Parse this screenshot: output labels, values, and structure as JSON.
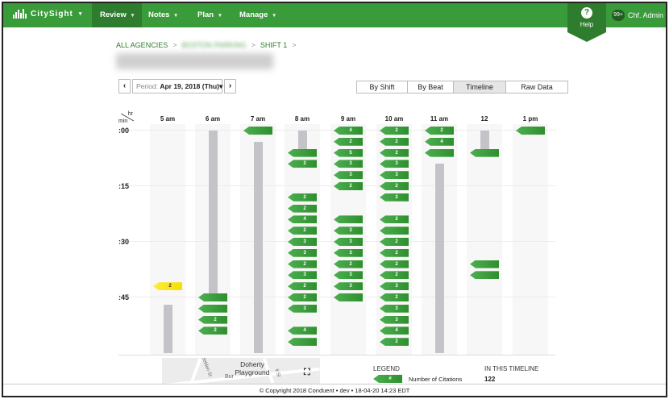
{
  "app": {
    "brand": "CitySight",
    "brand_caret": "▾"
  },
  "nav": {
    "items": [
      {
        "label": "Review",
        "caret": "▾"
      },
      {
        "label": "Notes",
        "caret": "▾"
      },
      {
        "label": "Plan",
        "caret": "▾"
      },
      {
        "label": "Manage",
        "caret": "▾"
      }
    ],
    "help_icon": "?",
    "help_label": "Help",
    "notifications": "99+",
    "user": "Chf. Admin ▾"
  },
  "breadcrumb": {
    "root": "ALL AGENCIES",
    "middle": "BOSTON PARKING",
    "current": "SHIFT 1",
    "separator": ">"
  },
  "period": {
    "prev": "‹",
    "next": "›",
    "label": "Period:",
    "value": "Apr 19, 2018 (Thu)▾"
  },
  "tabs": [
    "By Shift",
    "By Beat",
    "Timeline",
    "Raw Data"
  ],
  "active_tab": "Timeline",
  "timeline": {
    "corner_hr": "hr",
    "corner_min": "min",
    "hours": [
      "5 am",
      "6 am",
      "7 am",
      "8 am",
      "9 am",
      "10 am",
      "11 am",
      "12",
      "1 pm"
    ],
    "minute_labels": [
      ":00",
      ":15",
      ":30",
      ":45"
    ],
    "gray_bars": [
      {
        "hour": 0,
        "start_min": 47,
        "end_min": 60
      },
      {
        "hour": 1,
        "start_min": 0,
        "end_min": 44
      },
      {
        "hour": 2,
        "start_min": 3,
        "end_min": 60
      },
      {
        "hour": 3,
        "start_min": 0,
        "end_min": 6
      },
      {
        "hour": 6,
        "start_min": 9,
        "end_min": 60
      },
      {
        "hour": 7,
        "start_min": 0,
        "end_min": 6
      }
    ],
    "citations": [
      {
        "hour": 0,
        "min": 42,
        "count": "2",
        "color": "yellow"
      },
      {
        "hour": 1,
        "min": 45,
        "count": ""
      },
      {
        "hour": 1,
        "min": 48,
        "count": ""
      },
      {
        "hour": 1,
        "min": 51,
        "count": "2"
      },
      {
        "hour": 1,
        "min": 54,
        "count": "2"
      },
      {
        "hour": 2,
        "min": 0,
        "count": ""
      },
      {
        "hour": 3,
        "min": 6,
        "count": ""
      },
      {
        "hour": 3,
        "min": 9,
        "count": "2"
      },
      {
        "hour": 3,
        "min": 18,
        "count": "2"
      },
      {
        "hour": 3,
        "min": 21,
        "count": "2"
      },
      {
        "hour": 3,
        "min": 24,
        "count": "4"
      },
      {
        "hour": 3,
        "min": 27,
        "count": "2"
      },
      {
        "hour": 3,
        "min": 30,
        "count": "3"
      },
      {
        "hour": 3,
        "min": 33,
        "count": "3"
      },
      {
        "hour": 3,
        "min": 36,
        "count": "2"
      },
      {
        "hour": 3,
        "min": 39,
        "count": "3"
      },
      {
        "hour": 3,
        "min": 42,
        "count": "2"
      },
      {
        "hour": 3,
        "min": 45,
        "count": "2"
      },
      {
        "hour": 3,
        "min": 48,
        "count": "3"
      },
      {
        "hour": 3,
        "min": 54,
        "count": "4"
      },
      {
        "hour": 3,
        "min": 57,
        "count": ""
      },
      {
        "hour": 4,
        "min": 0,
        "count": "4"
      },
      {
        "hour": 4,
        "min": 3,
        "count": "2"
      },
      {
        "hour": 4,
        "min": 6,
        "count": "5"
      },
      {
        "hour": 4,
        "min": 9,
        "count": "3"
      },
      {
        "hour": 4,
        "min": 12,
        "count": "3"
      },
      {
        "hour": 4,
        "min": 15,
        "count": "2"
      },
      {
        "hour": 4,
        "min": 24,
        "count": ""
      },
      {
        "hour": 4,
        "min": 27,
        "count": "3"
      },
      {
        "hour": 4,
        "min": 30,
        "count": "3"
      },
      {
        "hour": 4,
        "min": 33,
        "count": "3"
      },
      {
        "hour": 4,
        "min": 36,
        "count": "2"
      },
      {
        "hour": 4,
        "min": 39,
        "count": "3"
      },
      {
        "hour": 4,
        "min": 42,
        "count": "3"
      },
      {
        "hour": 4,
        "min": 45,
        "count": ""
      },
      {
        "hour": 5,
        "min": 0,
        "count": "2"
      },
      {
        "hour": 5,
        "min": 3,
        "count": "2"
      },
      {
        "hour": 5,
        "min": 6,
        "count": "2"
      },
      {
        "hour": 5,
        "min": 9,
        "count": "3"
      },
      {
        "hour": 5,
        "min": 12,
        "count": "3"
      },
      {
        "hour": 5,
        "min": 15,
        "count": "2"
      },
      {
        "hour": 5,
        "min": 18,
        "count": "2"
      },
      {
        "hour": 5,
        "min": 24,
        "count": "2"
      },
      {
        "hour": 5,
        "min": 27,
        "count": ""
      },
      {
        "hour": 5,
        "min": 30,
        "count": "2"
      },
      {
        "hour": 5,
        "min": 33,
        "count": "2"
      },
      {
        "hour": 5,
        "min": 36,
        "count": "2"
      },
      {
        "hour": 5,
        "min": 39,
        "count": "2"
      },
      {
        "hour": 5,
        "min": 42,
        "count": "3"
      },
      {
        "hour": 5,
        "min": 45,
        "count": "2"
      },
      {
        "hour": 5,
        "min": 48,
        "count": "3"
      },
      {
        "hour": 5,
        "min": 51,
        "count": "3"
      },
      {
        "hour": 5,
        "min": 54,
        "count": "4"
      },
      {
        "hour": 5,
        "min": 57,
        "count": "2"
      },
      {
        "hour": 6,
        "min": 0,
        "count": "2"
      },
      {
        "hour": 6,
        "min": 3,
        "count": "4"
      },
      {
        "hour": 6,
        "min": 6,
        "count": ""
      },
      {
        "hour": 7,
        "min": 6,
        "count": ""
      },
      {
        "hour": 7,
        "min": 36,
        "count": ""
      },
      {
        "hour": 7,
        "min": 39,
        "count": ""
      },
      {
        "hour": 8,
        "min": 0,
        "count": ""
      }
    ]
  },
  "map": {
    "park_name": "Doherty Playground",
    "streets": [
      "Belden St",
      "Bur",
      "ll St"
    ],
    "fullscreen_icon": "⛶"
  },
  "legend": {
    "title": "LEGEND",
    "sample": "#",
    "desc": "Number of Citations",
    "in_timeline_title": "IN THIS TIMELINE",
    "in_timeline_value": "122"
  },
  "footer": {
    "copyright": "© Copyright 2018 Conduent • dev • 18-04-20 14:23 EDT"
  }
}
